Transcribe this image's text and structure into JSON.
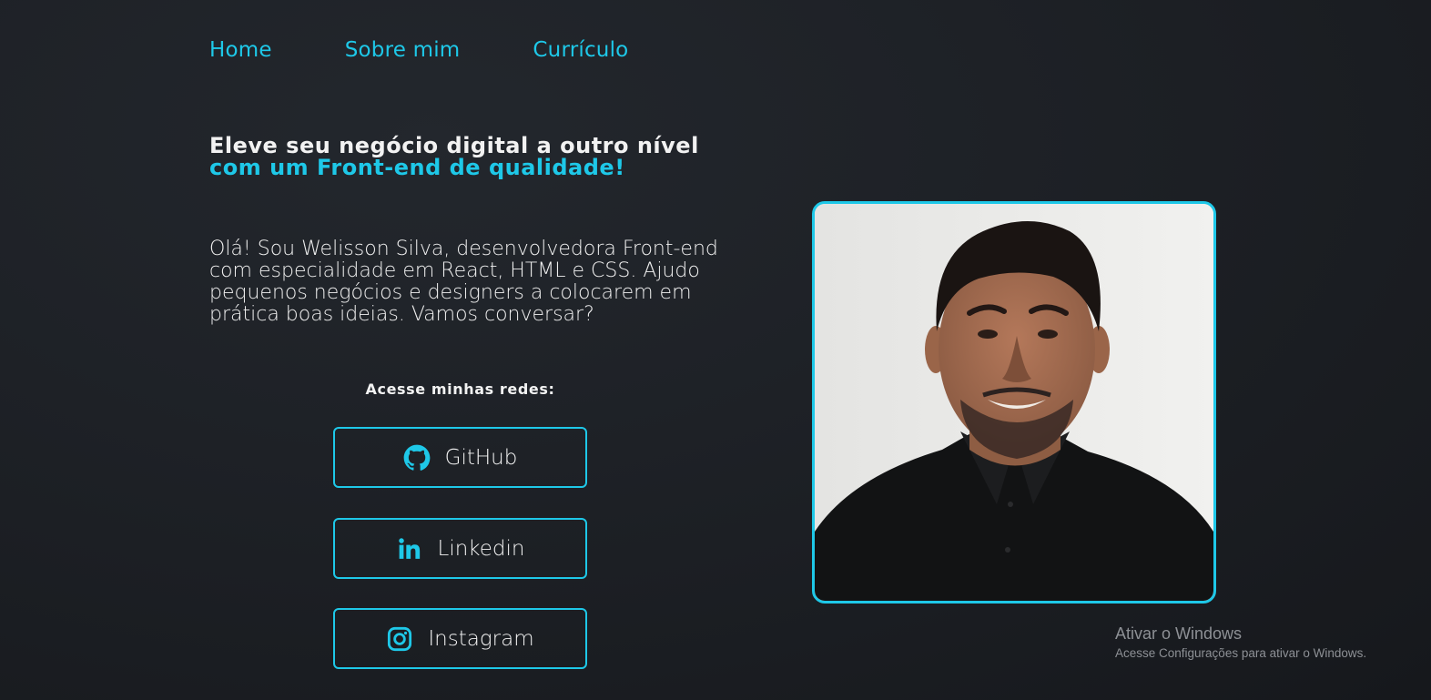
{
  "nav": {
    "items": [
      "Home",
      "Sobre mim",
      "Currículo"
    ]
  },
  "hero": {
    "headline_plain": "Eleve seu negócio digital a outro nível ",
    "headline_accent": "com um Front-end de qualidade!",
    "intro": "Olá! Sou Welisson Silva, desenvolvedora Front-end com especialidade em React, HTML e CSS. Ajudo pequenos negócios e designers a colocarem em prática boas ideias. Vamos conversar?"
  },
  "social": {
    "title": "Acesse minhas redes:",
    "buttons": [
      {
        "label": "GitHub",
        "icon": "github-icon"
      },
      {
        "label": "Linkedin",
        "icon": "linkedin-icon"
      },
      {
        "label": "Instagram",
        "icon": "instagram-icon"
      }
    ]
  },
  "photo": {
    "alt": "profile-photo"
  },
  "windows_watermark": {
    "title": "Ativar o Windows",
    "subtitle": "Acesse Configurações para ativar o Windows."
  },
  "colors": {
    "accent": "#1ec8e8",
    "background": "#1c1f24",
    "text": "#f2f2f2"
  }
}
